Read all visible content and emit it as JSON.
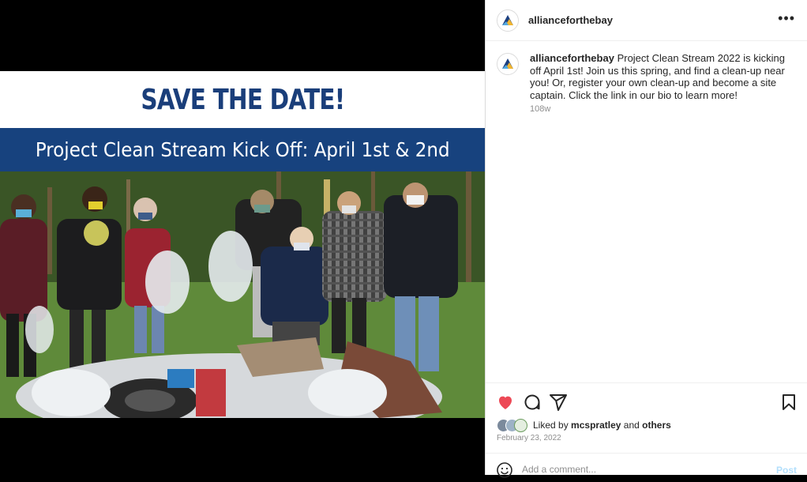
{
  "media": {
    "headline": "SAVE THE DATE!",
    "subheadline": "Project Clean Stream Kick Off: April 1st & 2nd"
  },
  "header": {
    "username": "alliancefor­thebay",
    "more_icon": "more-horizontal-icon"
  },
  "caption": {
    "username": "allianceforthebay",
    "text": "Project Clean Stream 2022 is kicking off April 1st! Join us this spring, and find a clean-up near you! Or, register your own clean-up and become a site captain. Click the link in our bio to learn more!",
    "age": "108w"
  },
  "actions": {
    "like_icon": "heart-filled-icon",
    "comment_icon": "comment-icon",
    "share_icon": "send-icon",
    "save_icon": "bookmark-icon",
    "like_color": "#ed4956"
  },
  "likes": {
    "prefix": "Liked by",
    "user": "mcspratley",
    "joiner": "and",
    "others": "others"
  },
  "date": "February 23, 2022",
  "comment": {
    "placeholder": "Add a comment...",
    "post_label": "Post",
    "emoji_icon": "emoji-smile-icon"
  }
}
